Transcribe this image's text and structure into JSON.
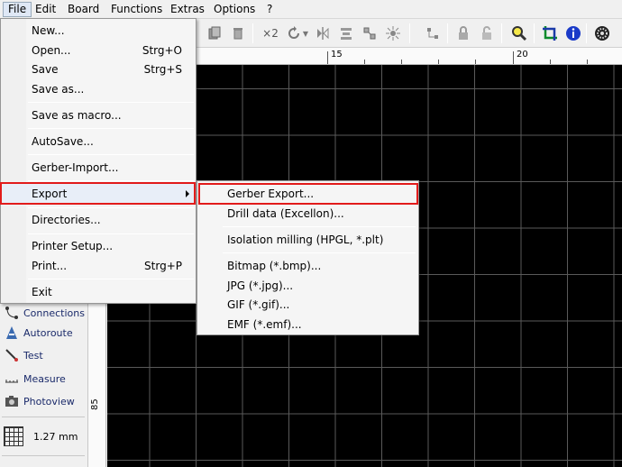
{
  "menubar": {
    "items": [
      "File",
      "Edit",
      "Board",
      "Functions",
      "Extras",
      "Options",
      "?"
    ]
  },
  "file_menu": {
    "items": [
      {
        "label": "New...",
        "shortcut": ""
      },
      {
        "label": "Open...",
        "shortcut": "Strg+O"
      },
      {
        "label": "Save",
        "shortcut": "Strg+S"
      },
      {
        "label": "Save as...",
        "shortcut": ""
      },
      {
        "label": "Save as macro...",
        "shortcut": ""
      },
      {
        "label": "AutoSave...",
        "shortcut": ""
      },
      {
        "label": "Gerber-Import...",
        "shortcut": ""
      },
      {
        "label": "Export",
        "shortcut": ""
      },
      {
        "label": "Directories...",
        "shortcut": ""
      },
      {
        "label": "Printer Setup...",
        "shortcut": ""
      },
      {
        "label": "Print...",
        "shortcut": "Strg+P"
      },
      {
        "label": "Exit",
        "shortcut": ""
      }
    ]
  },
  "export_submenu": {
    "items": [
      "Gerber Export...",
      "Drill data (Excellon)...",
      "Isolation milling (HPGL, *.plt)",
      "Bitmap (*.bmp)...",
      "JPG (*.jpg)...",
      "GIF (*.gif)...",
      "EMF (*.emf)..."
    ]
  },
  "toolbar": {
    "multiplier_label": "×2"
  },
  "ruler": {
    "top_labels": [
      "15",
      "20"
    ],
    "left_label": "85"
  },
  "left_panel": {
    "items": [
      "Connections",
      "Autoroute",
      "Test",
      "Measure",
      "Photoview"
    ],
    "grid_value": "1.27 mm"
  },
  "colors": {
    "highlight_box": "#e21b1b",
    "canvas": "#000000",
    "grid": "#5a5a5a"
  }
}
